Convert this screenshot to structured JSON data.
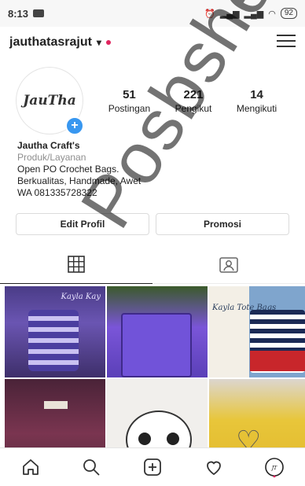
{
  "status_bar": {
    "time": "8:13",
    "battery": "92"
  },
  "header": {
    "username": "jauthatasrajut",
    "chevron": "⌄"
  },
  "profile": {
    "avatar_brand": "JauTha",
    "stats": [
      {
        "count": "51",
        "label": "Postingan"
      },
      {
        "count": "221",
        "label": "Pengikut"
      },
      {
        "count": "14",
        "label": "Mengikuti"
      }
    ]
  },
  "bio": {
    "name": "Jautha Craft's",
    "category": "Produk/Layanan",
    "line1": "Open PO Crochet Bags.",
    "line2": "Berkualitas, Handmade, Awet",
    "line3": "WA 081335728322"
  },
  "buttons": {
    "edit": "Edit Profil",
    "promo": "Promosi"
  },
  "posts": [
    {
      "caption": "Kayla Kay"
    },
    {
      "caption": ""
    },
    {
      "caption": "Kayla Tote Bags"
    },
    {
      "caption": ""
    },
    {
      "caption": ""
    },
    {
      "caption": ""
    }
  ],
  "watermark": "Posbshe",
  "icons": {
    "home": "home-icon",
    "search": "search-icon",
    "add": "add-post-icon",
    "activity": "heart-icon",
    "profile": "profile-avatar-icon",
    "menu": "menu-icon",
    "grid": "grid-icon",
    "tagged": "tagged-icon"
  },
  "colors": {
    "accent_blue": "#3897f0",
    "notification_red": "#e0245e"
  }
}
